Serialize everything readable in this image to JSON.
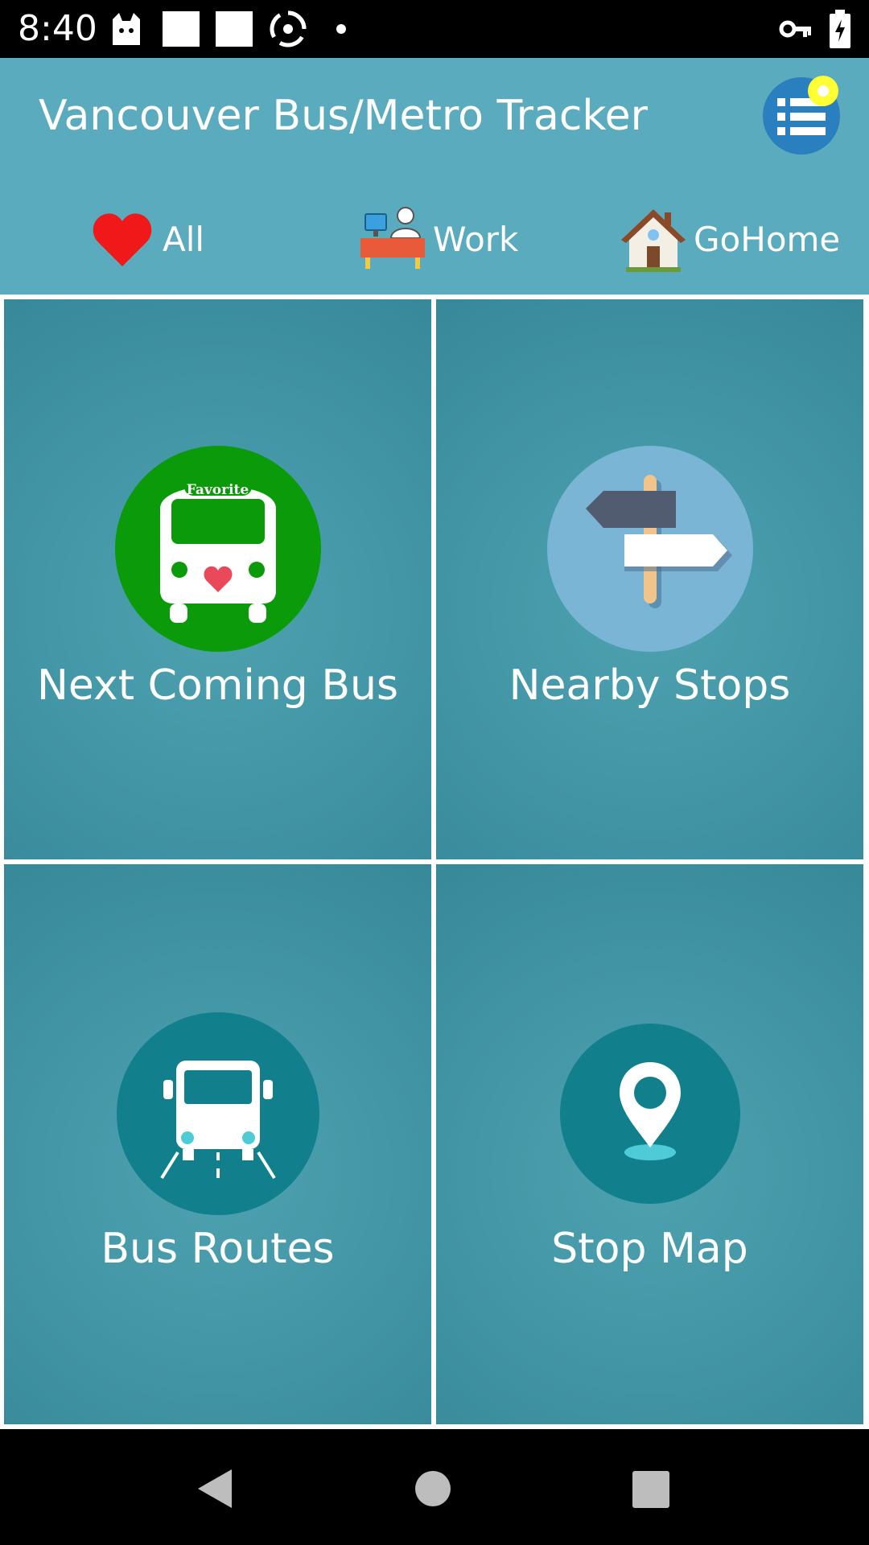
{
  "status_bar": {
    "time": "8:40"
  },
  "app_bar": {
    "title": "Vancouver Bus/Metro Tracker",
    "menu_icon": "list-menu-icon",
    "filters": [
      {
        "label": "All",
        "icon": "heart-icon"
      },
      {
        "label": "Work",
        "icon": "work-desk-icon"
      },
      {
        "label": "GoHome",
        "icon": "house-icon"
      }
    ]
  },
  "tiles": [
    {
      "label": "Next Coming Bus",
      "icon": "favorite-bus-icon",
      "badge": "Favorite"
    },
    {
      "label": "Nearby Stops",
      "icon": "signpost-icon"
    },
    {
      "label": "Bus Routes",
      "icon": "bus-route-icon"
    },
    {
      "label": "Stop Map",
      "icon": "map-pin-icon"
    }
  ],
  "colors": {
    "app_bar": "#5aabbd",
    "tile": "#4497a6",
    "favorite_green": "#0a9a0a",
    "signpost_circle": "#7ab5d6",
    "route_circle": "#127f8c",
    "menu_blue": "#2a7fbf",
    "notification_dot": "#ffff33"
  }
}
